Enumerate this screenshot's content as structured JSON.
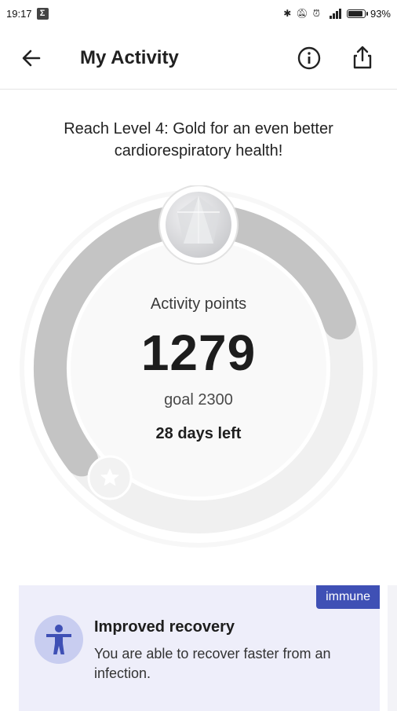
{
  "status_bar": {
    "time": "19:17",
    "notification_icon": "sigma-app-icon",
    "icons": [
      "bluetooth-icon",
      "mute-icon",
      "alarm-icon",
      "signal-4g-icon"
    ],
    "battery_percent": "93%",
    "battery_level": 0.93
  },
  "app_bar": {
    "title": "My Activity",
    "back_icon": "arrow-left-icon",
    "info_icon": "info-icon",
    "share_icon": "share-icon"
  },
  "headline": "Reach Level 4: Gold for an even better cardiorespiratory health!",
  "activity": {
    "label": "Activity points",
    "points": "1279",
    "goal_text": "goal 2300",
    "days_left": "28 days left",
    "progress": 0.556
  },
  "card": {
    "tag": "immune",
    "title": "Improved recovery",
    "body": "You are able to recover faster from an infection.",
    "icon": "person-accessibility-icon"
  },
  "colors": {
    "accent": "#3f50b5",
    "card_bg": "#eeeefa",
    "ring_track": "#f0f0f0",
    "ring_progress": "#c4c4c4"
  }
}
